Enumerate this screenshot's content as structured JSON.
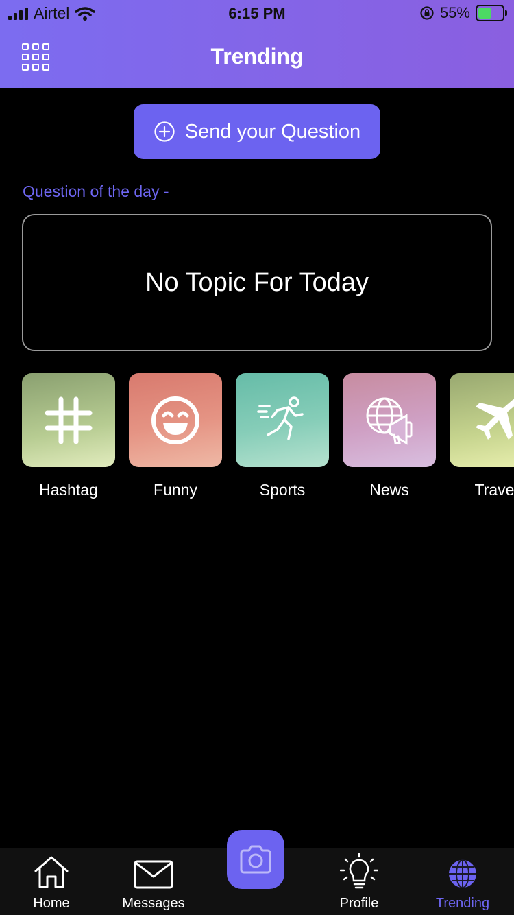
{
  "status_bar": {
    "carrier": "Airtel",
    "time": "6:15 PM",
    "battery": "55%",
    "battery_level": 0.55
  },
  "header": {
    "title": "Trending",
    "menu_icon": "grid-icon"
  },
  "send_button": {
    "label": "Send your Question",
    "icon": "plus-circle-icon"
  },
  "question_of_day": {
    "label": "Question of the day -",
    "topic": "No Topic For Today"
  },
  "categories": [
    {
      "label": "Hashtag",
      "icon": "hashtag-icon"
    },
    {
      "label": "Funny",
      "icon": "smile-icon"
    },
    {
      "label": "Sports",
      "icon": "runner-icon"
    },
    {
      "label": "News",
      "icon": "globe-megaphone-icon"
    },
    {
      "label": "Travel",
      "icon": "airplane-icon"
    }
  ],
  "bottom_nav": {
    "items": [
      {
        "label": "Home",
        "icon": "home-icon"
      },
      {
        "label": "Messages",
        "icon": "mail-icon"
      },
      {
        "label": "Profile",
        "icon": "lightbulb-icon"
      },
      {
        "label": "Trending",
        "icon": "globe-icon",
        "active": true
      }
    ],
    "camera_icon": "camera-icon"
  },
  "colors": {
    "accent": "#6c63f0",
    "header_gradient_start": "#7c6cf0",
    "header_gradient_end": "#8a5fe0",
    "background": "#000000"
  }
}
